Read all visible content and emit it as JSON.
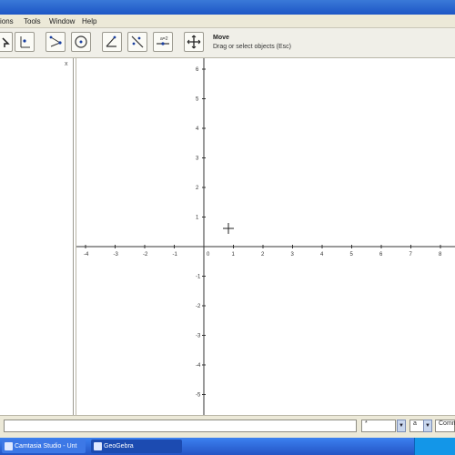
{
  "menubar": {
    "items": [
      "ions",
      "Tools",
      "Window",
      "Help"
    ]
  },
  "toolbar": {
    "tools": [
      "move-tool",
      "point-tool",
      "line-tool",
      "perpendicular-tool",
      "polygon-tool",
      "circle-tool",
      "angle-tool",
      "reflect-tool",
      "slider-tool",
      "move-graphics-view-tool"
    ],
    "active_tool_title": "Move",
    "active_tool_description": "Drag or select objects (Esc)"
  },
  "algebra_view": {
    "close_label": "x"
  },
  "graphics_view": {
    "x_ticks": [
      "-4",
      "-3",
      "-2",
      "-1",
      "0",
      "1",
      "2",
      "3",
      "4",
      "5",
      "6",
      "7",
      "8"
    ],
    "y_ticks": [
      "6",
      "5",
      "4",
      "3",
      "2",
      "1",
      "0",
      "-1",
      "-2",
      "-3",
      "-4",
      "-5"
    ]
  },
  "input_bar": {
    "input_value": "",
    "symbol_select": "*",
    "alpha_select": "a",
    "command_select": "Comm"
  },
  "taskbar": {
    "buttons": [
      "Camtasia Studio - Unt",
      "GeoGebra"
    ]
  }
}
